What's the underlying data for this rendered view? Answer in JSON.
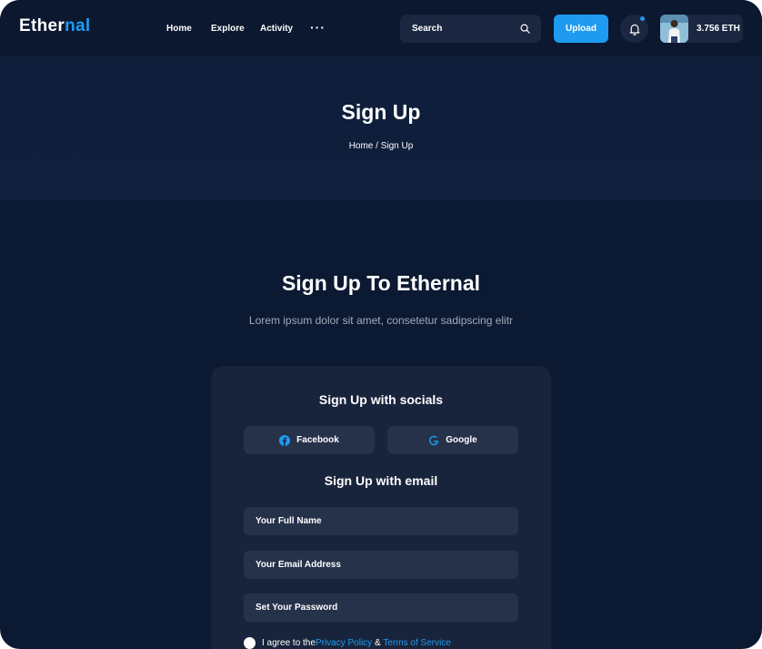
{
  "brand": {
    "logo_main": "Ether",
    "logo_accent": "nal",
    "accent_color": "#1e9bf0"
  },
  "nav": {
    "home": "Home",
    "explore": "Explore",
    "activity": "Activity",
    "more": "···"
  },
  "search": {
    "placeholder": "Search"
  },
  "header": {
    "upload_label": "Upload",
    "balance": "3.756 ETH"
  },
  "hero": {
    "title": "Sign Up",
    "crumb_home": "Home",
    "crumb_sep": " / ",
    "crumb_current": "Sign Up"
  },
  "main": {
    "title": "Sign Up To Ethernal",
    "subtitle": "Lorem ipsum dolor sit amet, consetetur sadipscing elitr"
  },
  "card": {
    "socials_heading": "Sign Up with socials",
    "facebook_label": "Facebook",
    "google_label": "Google",
    "email_heading": "Sign Up with email",
    "name_placeholder": "Your Full Name",
    "email_placeholder": "Your Email Address",
    "password_placeholder": "Set Your Password",
    "agree_prefix": "I agree to the ",
    "privacy_link": "Privacy Policy",
    "agree_and": " & ",
    "terms_link": "Terms of Service"
  },
  "icons": [
    "search-icon",
    "bell-icon",
    "facebook-icon",
    "google-icon",
    "avatar"
  ]
}
